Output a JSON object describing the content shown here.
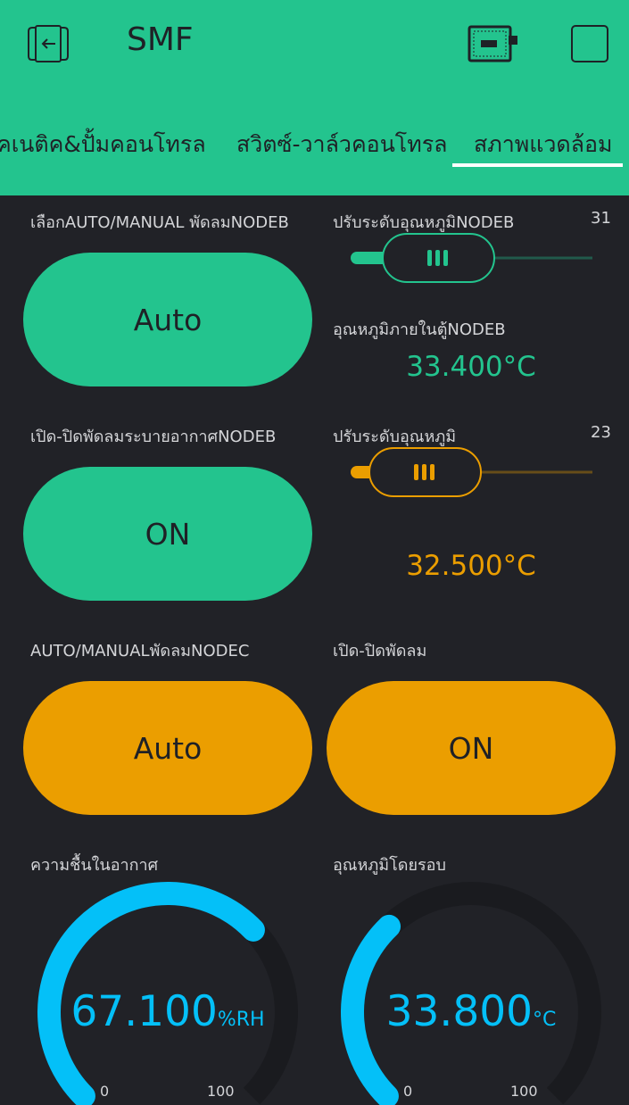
{
  "header": {
    "title": "SMF"
  },
  "tabs": [
    {
      "label": "คเนติค&ปั้มคอนโทรล"
    },
    {
      "label": "สวิตซ์-วาล์วคอนโทรล"
    },
    {
      "label": "สภาพแวดล้อม"
    }
  ],
  "widgets": {
    "auto_manual_nodeb": {
      "label": "เลือกAUTO/MANUAL พัดลมNODEB",
      "button": "Auto",
      "color": "#23c48e"
    },
    "temp_adjust_nodeb": {
      "label": "ปรับระดับอุณหภูมิNODEB",
      "value": "31",
      "fill": 0.14,
      "color": "#23c48e"
    },
    "temp_inside_nodeb": {
      "label": "อุณหภูมิภายในตู้NODEB",
      "value": "33.400°C",
      "color": "#23c48e"
    },
    "fan_nodeb": {
      "label": "เปิด-ปิดพัดลมระบายอากาศNODEB",
      "button": "ON",
      "color": "#23c48e"
    },
    "temp_adjust": {
      "label": "ปรับระดับอุณหภูมิ",
      "value": "23",
      "fill": 0.1,
      "color": "#eb9e00"
    },
    "temp_value": {
      "value": "32.500°C",
      "color": "#eb9e00"
    },
    "auto_manual_nodec": {
      "label": "AUTO/MANUALพัดลมNODEC",
      "button": "Auto",
      "color": "#eb9e00"
    },
    "fan": {
      "label": "เปิด-ปิดพัดลม",
      "button": "ON",
      "color": "#eb9e00"
    },
    "humidity": {
      "label": "ความชื้นในอากาศ",
      "value": "67.100",
      "unit": "%RH",
      "min": "0",
      "max": "100",
      "level": 0.671,
      "color": "#04c0f8"
    },
    "ambient_temp": {
      "label": "อุณหภูมิโดยรอบ",
      "value": "33.800",
      "unit": "°C",
      "min": "0",
      "max": "100",
      "level": 0.338,
      "color": "#04c0f8"
    }
  }
}
